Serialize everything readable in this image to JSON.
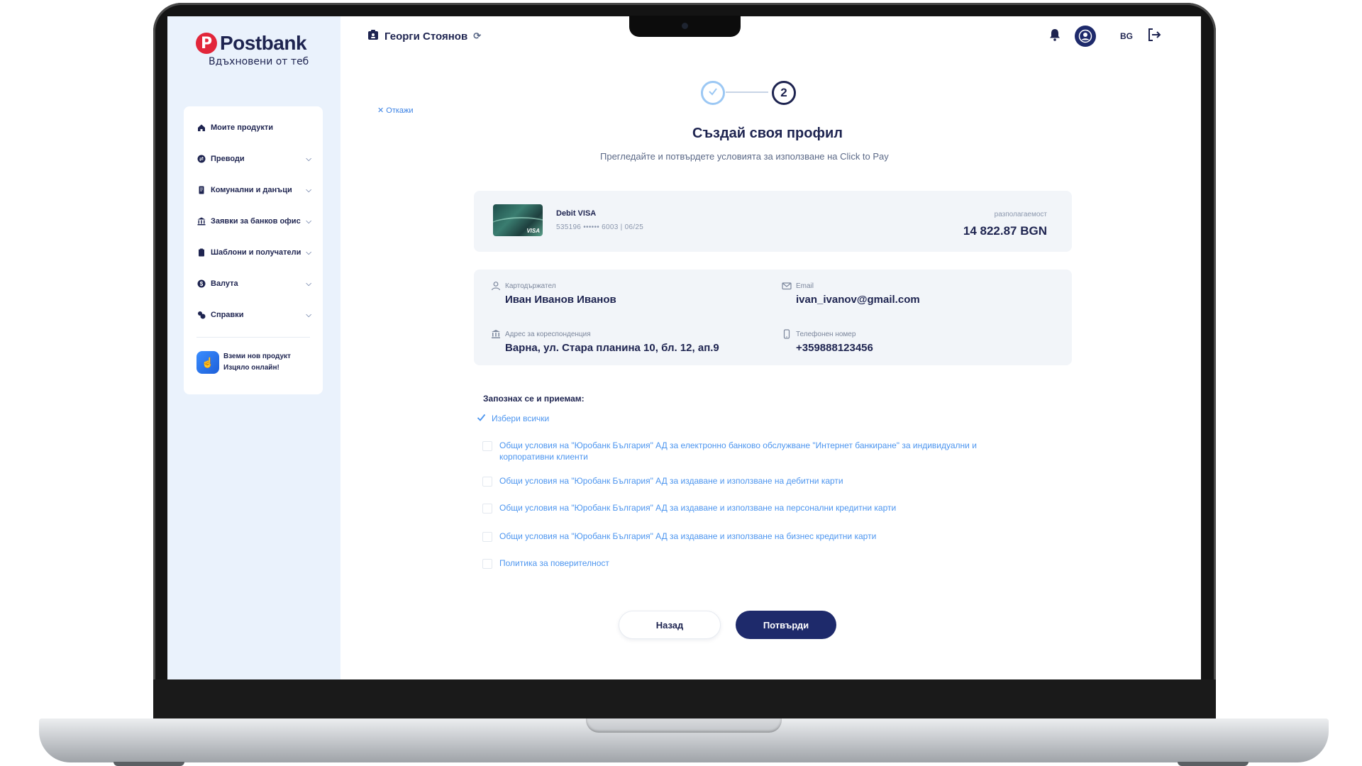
{
  "brand": {
    "logo_letter": "P",
    "name": "Postbank",
    "tagline": "Вдъхновени от теб",
    "accent_color": "#e2263a",
    "primary_color": "#1e2450"
  },
  "sidebar": {
    "items": [
      {
        "label": "Моите продукти",
        "icon": "home-icon",
        "has_chevron": false
      },
      {
        "label": "Преводи",
        "icon": "transfer-icon",
        "has_chevron": true
      },
      {
        "label": "Комунални и данъци",
        "icon": "receipt-icon",
        "has_chevron": true
      },
      {
        "label": "Заявки за банков офис",
        "icon": "bank-icon",
        "has_chevron": true
      },
      {
        "label": "Шаблони и получатели",
        "icon": "clipboard-icon",
        "has_chevron": true
      },
      {
        "label": "Валута",
        "icon": "currency-icon",
        "has_chevron": true
      },
      {
        "label": "Справки",
        "icon": "report-icon",
        "has_chevron": true
      }
    ],
    "promo": {
      "title": "Вземи нов продукт",
      "subtitle": "Изцяло онлайн!"
    }
  },
  "header": {
    "user_name": "Георги Стоянов",
    "language": "BG"
  },
  "stepper": {
    "current_step": "2",
    "completed_steps": 1,
    "total_steps": 2
  },
  "main": {
    "cancel_label": "Откажи",
    "title": "Създай своя профил",
    "subtitle": "Прегледайте и потвърдете условията за използване на Click to Pay"
  },
  "card": {
    "name": "Debit VISA",
    "number": "535196 •••••• 6003 | 06/25",
    "available_label": "разполагаемост",
    "available_amount": "14 822.87 BGN",
    "brand_mark": "VISA"
  },
  "holder": {
    "cardholder_label": "Картодържател",
    "cardholder_value": "Иван Иванов Иванов",
    "email_label": "Email",
    "email_value": "ivan_ivanov@gmail.com",
    "address_label": "Адрес за кореспонденция",
    "address_value": "Варна, ул. Стара планина 10, бл. 12, ап.9",
    "phone_label": "Телефонен номер",
    "phone_value": "+359888123456"
  },
  "terms": {
    "heading": "Запознах се и приемам:",
    "select_all": "Избери всички",
    "items": [
      "Общи условия на \"Юробанк България\" АД за електронно банково обслужване \"Интернет банкиране\" за индивидуални  и корпоративни клиенти",
      "Общи условия на \"Юробанк България\" АД за издаване и използване на дебитни карти",
      "Общи условия на \"Юробанк България\" АД за издаване и използване на персонални кредитни карти",
      "Общи условия на \"Юробанк България\" АД за издаване и използване на бизнес кредитни карти",
      "Политика за поверителност"
    ]
  },
  "actions": {
    "back_label": "Назад",
    "confirm_label": "Потвърди"
  }
}
